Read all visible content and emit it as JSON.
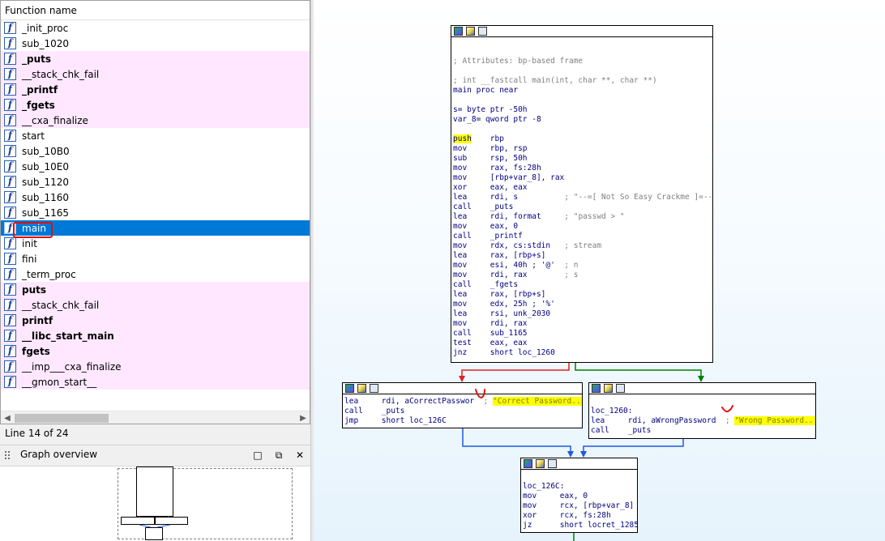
{
  "functions_panel": {
    "header": "Function name",
    "items": [
      {
        "name": "_init_proc",
        "kind": "normal",
        "bold": false
      },
      {
        "name": "sub_1020",
        "kind": "normal",
        "bold": false
      },
      {
        "name": "_puts",
        "kind": "library",
        "bold": true
      },
      {
        "name": "__stack_chk_fail",
        "kind": "library",
        "bold": false
      },
      {
        "name": "_printf",
        "kind": "library",
        "bold": true
      },
      {
        "name": "_fgets",
        "kind": "library",
        "bold": true
      },
      {
        "name": "__cxa_finalize",
        "kind": "library",
        "bold": false
      },
      {
        "name": "start",
        "kind": "normal",
        "bold": false
      },
      {
        "name": "sub_10B0",
        "kind": "normal",
        "bold": false
      },
      {
        "name": "sub_10E0",
        "kind": "normal",
        "bold": false
      },
      {
        "name": "sub_1120",
        "kind": "normal",
        "bold": false
      },
      {
        "name": "sub_1160",
        "kind": "normal",
        "bold": false
      },
      {
        "name": "sub_1165",
        "kind": "normal",
        "bold": false
      },
      {
        "name": "main",
        "kind": "selected",
        "bold": false
      },
      {
        "name": "init",
        "kind": "normal",
        "bold": false
      },
      {
        "name": "fini",
        "kind": "normal",
        "bold": false
      },
      {
        "name": "_term_proc",
        "kind": "normal",
        "bold": false
      },
      {
        "name": "puts",
        "kind": "library",
        "bold": true
      },
      {
        "name": "__stack_chk_fail",
        "kind": "library",
        "bold": false
      },
      {
        "name": "printf",
        "kind": "library",
        "bold": true
      },
      {
        "name": "__libc_start_main",
        "kind": "library",
        "bold": true
      },
      {
        "name": "fgets",
        "kind": "library",
        "bold": true
      },
      {
        "name": "__imp___cxa_finalize",
        "kind": "library",
        "bold": false
      },
      {
        "name": "__gmon_start__",
        "kind": "library",
        "bold": false
      }
    ],
    "icon": "function-f-icon",
    "status": "Line 14 of 24"
  },
  "graph_overview": {
    "title": "Graph overview",
    "buttons": [
      "restore-icon",
      "float-icon",
      "close-icon"
    ],
    "button_glyphs": [
      "□",
      "⧉",
      "✕"
    ]
  },
  "graph": {
    "colors": {
      "true_edge": "#008000",
      "false_edge": "#e02020",
      "uncond_edge": "#1e5ae0",
      "highlight": "#ffff00"
    },
    "main_block": {
      "lines": [
        {
          "t": "",
          "c": "cmt"
        },
        {
          "t": "",
          "c": "cmt"
        },
        {
          "t": "; Attributes: bp-based frame",
          "c": "cmt"
        },
        {
          "t": "",
          "c": "cmt"
        },
        {
          "t": "; int __fastcall main(int, char **, char **)",
          "c": "cmt"
        },
        {
          "t": "main proc near",
          "c": "mn"
        },
        {
          "t": "",
          "c": "mn"
        },
        {
          "t": "s= byte ptr -50h",
          "c": "mn"
        },
        {
          "t": "var_8= qword ptr -8",
          "c": "mn"
        },
        {
          "t": "",
          "c": "mn"
        },
        {
          "op": "push",
          "arg": "rbp",
          "hl": true
        },
        {
          "op": "mov",
          "arg": "rbp, rsp"
        },
        {
          "op": "sub",
          "arg": "rsp, 50h"
        },
        {
          "op": "mov",
          "arg": "rax, fs:28h"
        },
        {
          "op": "mov",
          "arg": "[rbp+var_8], rax"
        },
        {
          "op": "xor",
          "arg": "eax, eax"
        },
        {
          "op": "lea",
          "arg": "rdi, s",
          "cmt": "; \"--=[ Not So Easy Crackme ]=--\"",
          "cpad": 16
        },
        {
          "op": "call",
          "arg": "_puts"
        },
        {
          "op": "lea",
          "arg": "rdi, format",
          "cmt": "; \"passwd > \"",
          "cpad": 16
        },
        {
          "op": "mov",
          "arg": "eax, 0"
        },
        {
          "op": "call",
          "arg": "_printf"
        },
        {
          "op": "mov",
          "arg": "rdx, cs:stdin",
          "cmt": "; stream",
          "cpad": 16
        },
        {
          "op": "lea",
          "arg": "rax, [rbp+s]"
        },
        {
          "op": "mov",
          "arg": "esi, 40h ; '@'",
          "cmt": "; n",
          "cpad": 16
        },
        {
          "op": "mov",
          "arg": "rdi, rax",
          "cmt": "; s",
          "cpad": 16
        },
        {
          "op": "call",
          "arg": "_fgets"
        },
        {
          "op": "lea",
          "arg": "rax, [rbp+s]"
        },
        {
          "op": "mov",
          "arg": "edx, 25h ; '%'"
        },
        {
          "op": "lea",
          "arg": "rsi, unk_2030"
        },
        {
          "op": "mov",
          "arg": "rdi, rax"
        },
        {
          "op": "call",
          "arg": "sub_1165"
        },
        {
          "op": "test",
          "arg": "eax, eax"
        },
        {
          "op": "jnz",
          "arg": "short loc_1260"
        }
      ]
    },
    "correct_block": {
      "lines": [
        {
          "op": "lea",
          "arg": "rdi, aCorrectPasswor",
          "cmt": "; ",
          "str": "\"Correct Password...\"",
          "cpad": 0
        },
        {
          "op": "call",
          "arg": "_puts"
        },
        {
          "op": "jmp",
          "arg": "short loc_126C"
        }
      ]
    },
    "wrong_block": {
      "lines": [
        {
          "t": "",
          "c": "mn"
        },
        {
          "t": "loc_1260:",
          "c": "mn"
        },
        {
          "op": "lea",
          "arg": "rdi, aWrongPassword",
          "cmt": "; ",
          "str": "\"Wrong Password...\"",
          "cpad": 0
        },
        {
          "op": "call",
          "arg": "_puts"
        }
      ]
    },
    "end_block": {
      "lines": [
        {
          "t": "",
          "c": "mn"
        },
        {
          "t": "loc_126C:",
          "c": "mn"
        },
        {
          "op": "mov",
          "arg": "eax, 0"
        },
        {
          "op": "mov",
          "arg": "rcx, [rbp+var_8]"
        },
        {
          "op": "xor",
          "arg": "rcx, fs:28h"
        },
        {
          "op": "jz",
          "arg": "short locret_1285"
        }
      ]
    }
  }
}
